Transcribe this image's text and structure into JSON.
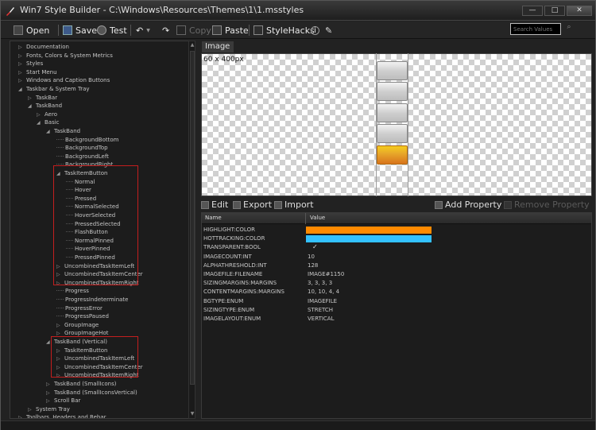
{
  "titlebar": {
    "title": "Win7 Style Builder - C:\\Windows\\Resources\\Themes\\1\\1.msstyles",
    "minimize": "—",
    "maximize": "□",
    "close": "✕"
  },
  "toolbar": {
    "open": "Open",
    "save": "Save",
    "test": "Test",
    "copy": "Copy",
    "paste": "Paste",
    "stylehacks": "StyleHacks",
    "search_placeholder": "Search Values"
  },
  "tree": [
    {
      "label": "Documentation",
      "arrow": "▷"
    },
    {
      "label": "Fonts, Colors & System Metrics",
      "arrow": "▷"
    },
    {
      "label": "Styles",
      "arrow": "▷"
    },
    {
      "label": "Start Menu",
      "arrow": "▷"
    },
    {
      "label": "Windows and Caption Buttons",
      "arrow": "▷"
    },
    {
      "label": "Taskbar & System Tray",
      "arrow": "◢"
    },
    {
      "label": "TaskBar",
      "arrow": "▷"
    },
    {
      "label": "TaskBand",
      "arrow": "◢"
    },
    {
      "label": "Aero",
      "arrow": "▷"
    },
    {
      "label": "Basic",
      "arrow": "◢"
    },
    {
      "label": "TaskBand",
      "arrow": "◢"
    },
    {
      "label": "BackgroundBottom",
      "arrow": ""
    },
    {
      "label": "BackgroundTop",
      "arrow": ""
    },
    {
      "label": "BackgroundLeft",
      "arrow": ""
    },
    {
      "label": "BackgroundRight",
      "arrow": ""
    },
    {
      "label": "TaskItemButton",
      "arrow": "◢"
    },
    {
      "label": "Normal",
      "arrow": ""
    },
    {
      "label": "Hover",
      "arrow": ""
    },
    {
      "label": "Pressed",
      "arrow": ""
    },
    {
      "label": "NormalSelected",
      "arrow": ""
    },
    {
      "label": "HoverSelected",
      "arrow": ""
    },
    {
      "label": "PressedSelected",
      "arrow": ""
    },
    {
      "label": "FlashButton",
      "arrow": ""
    },
    {
      "label": "NormalPinned",
      "arrow": ""
    },
    {
      "label": "HoverPinned",
      "arrow": ""
    },
    {
      "label": "PressedPinned",
      "arrow": ""
    },
    {
      "label": "UncombinedTaskItemLeft",
      "arrow": "▷"
    },
    {
      "label": "UncombinedTaskItemCenter",
      "arrow": "▷"
    },
    {
      "label": "UncombinedTaskItemRight",
      "arrow": "▷"
    },
    {
      "label": "Progress",
      "arrow": ""
    },
    {
      "label": "ProgressIndeterminate",
      "arrow": ""
    },
    {
      "label": "ProgressError",
      "arrow": ""
    },
    {
      "label": "ProgressPaused",
      "arrow": ""
    },
    {
      "label": "GroupImage",
      "arrow": "▷"
    },
    {
      "label": "GroupImageHot",
      "arrow": "▷"
    },
    {
      "label": "TaskBand (Vertical)",
      "arrow": "◢"
    },
    {
      "label": "TaskItemButton",
      "arrow": "▷"
    },
    {
      "label": "UncombinedTaskItemLeft",
      "arrow": "▷"
    },
    {
      "label": "UncombinedTaskItemCenter",
      "arrow": "▷"
    },
    {
      "label": "UncombinedTaskItemRight",
      "arrow": "▷"
    },
    {
      "label": "TaskBand (SmallIcons)",
      "arrow": "▷"
    },
    {
      "label": "TaskBand (SmallIconsVertical)",
      "arrow": "▷"
    },
    {
      "label": "Scroll Bar",
      "arrow": "▷"
    },
    {
      "label": "System Tray",
      "arrow": "▷"
    },
    {
      "label": "Toolbars, Headers and Rebar",
      "arrow": "▷"
    }
  ],
  "image_panel": {
    "tab": "Image",
    "dimensions": "60 x 400px"
  },
  "actions": {
    "edit": "Edit",
    "export": "Export",
    "import": "Import",
    "add_property": "Add Property",
    "remove_property": "Remove Property"
  },
  "properties": {
    "col_name": "Name",
    "col_value": "Value",
    "rows": [
      {
        "name": "HIGHLIGHT:COLOR",
        "value": "",
        "color": "#ff8a00"
      },
      {
        "name": "HOTTRACKING:COLOR",
        "value": "",
        "color": "#33c1ff"
      },
      {
        "name": "TRANSPARENT:BOOL",
        "value": "✓",
        "color": ""
      },
      {
        "name": "IMAGECOUNT:INT",
        "value": "10",
        "color": ""
      },
      {
        "name": "ALPHATHRESHOLD:INT",
        "value": "128",
        "color": ""
      },
      {
        "name": "IMAGEFILE:FILENAME",
        "value": "IMAGE#1150",
        "color": ""
      },
      {
        "name": "SIZINGMARGINS:MARGINS",
        "value": "3, 3, 3, 3",
        "color": ""
      },
      {
        "name": "CONTENTMARGINS:MARGINS",
        "value": "10, 10, 4, 4",
        "color": ""
      },
      {
        "name": "BGTYPE:ENUM",
        "value": "IMAGEFILE",
        "color": ""
      },
      {
        "name": "SIZINGTYPE:ENUM",
        "value": "STRETCH",
        "color": ""
      },
      {
        "name": "IMAGELAYOUT:ENUM",
        "value": "VERTICAL",
        "color": ""
      }
    ]
  }
}
